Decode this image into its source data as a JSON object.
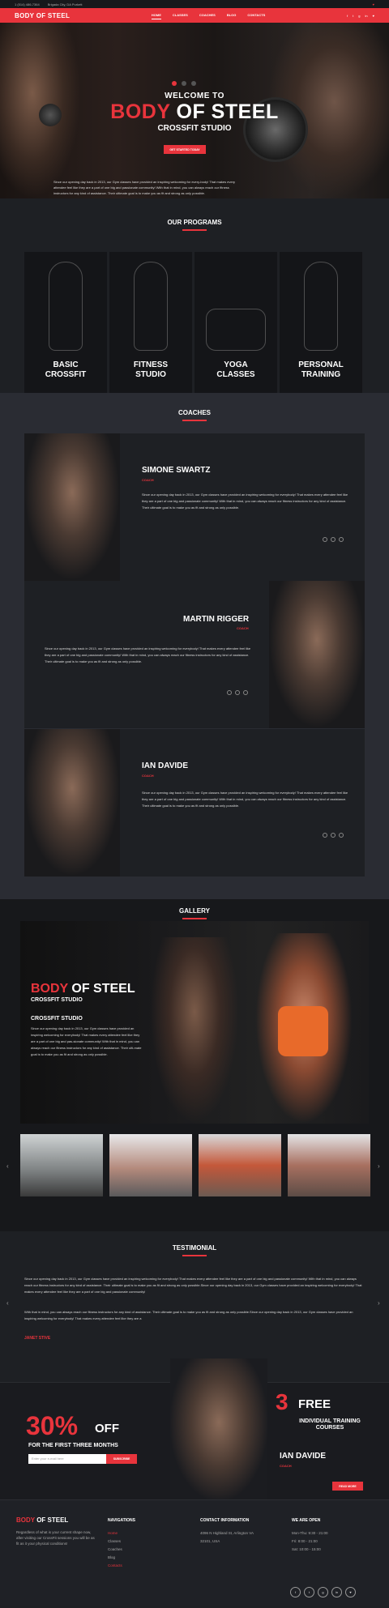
{
  "topbar": {
    "phone": "1 (514) 486-7364",
    "address": "Brigada City, DA Purkett",
    "cart": "♥"
  },
  "nav": {
    "logo": "BODY OF STEEL",
    "items": [
      "HOME",
      "CLASSES",
      "COACHES",
      "BLOG",
      "CONTACTS"
    ],
    "social": [
      "f",
      "t",
      "g",
      "in",
      "♥"
    ]
  },
  "hero": {
    "welcome": "WELCOME TO",
    "title_a": "BODY",
    "title_b": "OF STEEL",
    "subtitle": "CROSSFIT STUDIO",
    "cta": "GET STARTED TODAY",
    "text": "Since our opening day back in 2013, our Gym classes have provided an inspiring welcoming for every-body! That makes every attendee feel like they are a part of one big and passionate community! With that in mind, you can always reach our fitness instructors for any kind of assistance. Their ultimate goal is to make you as fit and strong as only possible."
  },
  "programs": {
    "title": "OUR PROGRAMS",
    "items": [
      {
        "l1": "BASIC",
        "l2": "CROSSFIT"
      },
      {
        "l1": "FITNESS",
        "l2": "STUDIO"
      },
      {
        "l1": "YOGA",
        "l2": "CLASSES"
      },
      {
        "l1": "PERSONAL",
        "l2": "TRAINING"
      }
    ]
  },
  "coaches": {
    "title": "COACHES",
    "items": [
      {
        "name": "SIMONE SWARTZ",
        "role": "COACH",
        "text": "Since our opening day back in 2013, our Gym classes have provided an inspiring welcoming for everybody! That makes every attendee feel like they are a part of one big and passionate community! With that in mind, you can always reach our fitness instructors for any kind of assistance. Their ultimate goal is to make you as fit and strong as only possible."
      },
      {
        "name": "MARTIN RIGGER",
        "role": "COACH",
        "text": "Since our opening day back in 2013, our Gym classes have provided an inspiring welcoming for everybody! That makes every attendee feel like they are a part of one big and passionate community! With that in mind, you can always reach our fitness instructors for any kind of assistance. Their ultimate goal is to make you as fit and strong as only possible."
      },
      {
        "name": "IAN DAVIDE",
        "role": "COACH",
        "text": "Since our opening day back in 2013, our Gym classes have provided an inspiring welcoming for everybody! That makes every attendee feel like they are a part of one big and passionate community! With that in mind, you can always reach our fitness instructors for any kind of assistance. Their ultimate goal is to make you as fit and strong as only possible."
      }
    ]
  },
  "gallery": {
    "title": "GALLERY",
    "brand_a": "BODY",
    "brand_b": "OF STEEL",
    "sub": "CROSSFIT STUDIO",
    "heading": "CROSSFIT STUDIO",
    "text": "Since our opening day back in 2013, our Gym classes have provided an inspiring welcoming for everybody! That makes every attendee feel like they are a part of one big and pas-sionate community! With that in mind, you can always reach our fitness instructors for any kind of assistance. Their ulti-mate goal is to make you as fit and strong as only possible."
  },
  "testimonial": {
    "title": "TESTIMONIAL",
    "p1": "Since our opening day back in 2013, our Gym classes have provided an inspiring welcoming for everybody! That makes every attendee feel like they are a part of one big and passionate community! With that in mind, you can always reach our fitness instructors for any kind of assistance. Their ultimate goal is to make you as fit and strong as only possible.Since our opening day back in 2013, our Gym classes have provided an inspiring welcoming for everybody! That makes every attendee feel like they are a part of one big and passionate community!",
    "p2": "With that in mind, you can always reach our fitness instructors for any kind of assistance. Their ultimate goal is to make you as fit and strong as only possible.Since our opening day back in 2013, our Gym classes have provided an inspiring welcoming for everybody! That makes every attendee feel like they are a",
    "author": "JANET STIVE"
  },
  "promo": {
    "percent": "30%",
    "off": "OFF",
    "first": "FOR THE FIRST THREE MONTHS",
    "email_placeholder": "Enter your e-mail here",
    "subscribe": "SUBSCRIBE",
    "three": "3",
    "free": "FREE",
    "courses": "INDIVIDUAL TRAINING COURSES",
    "name": "IAN DAVIDE",
    "role": "COACH",
    "read": "READ MORE"
  },
  "footer": {
    "brand_a": "BODY",
    "brand_b": "OF STEEL",
    "about": "Regardless of what is your current shape now, after visiting our CrossFit sessions you will be as fit as it your physical conditions!",
    "nav_title": "NAVIGATIONS",
    "nav": [
      "Home",
      "Classes",
      "Coaches",
      "Blog",
      "Contacts"
    ],
    "contact_title": "CONTACT INFORMATION",
    "contact": [
      "4096 N Highland St, Arlington VA",
      "32101, USA"
    ],
    "hours_title": "WE ARE OPEN",
    "hours": [
      "Mon-Thu: 9:30 - 21:00",
      "Fri: 8:00 - 21:00",
      "Sat: 10:00 - 15:00"
    ],
    "social": [
      "f",
      "t",
      "g",
      "in",
      "♥"
    ]
  },
  "colors": {
    "accent": "#e8343c",
    "dark": "#1e2024"
  }
}
